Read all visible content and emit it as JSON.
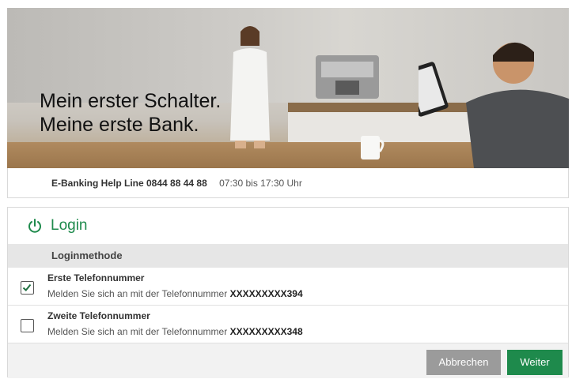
{
  "banner": {
    "line1": "Mein erster Schalter.",
    "line2": "Meine erste Bank."
  },
  "helpline": {
    "label": "E-Banking Help Line 0844 88 44 88",
    "hours": "07:30 bis 17:30 Uhr"
  },
  "login": {
    "title": "Login",
    "method_header": "Loginmethode",
    "options": [
      {
        "title": "Erste Telefonnummer",
        "desc_prefix": "Melden Sie sich an mit der Telefonnummer",
        "number": "XXXXXXXXX394",
        "checked": true
      },
      {
        "title": "Zweite Telefonnummer",
        "desc_prefix": "Melden Sie sich an mit der Telefonnummer",
        "number": "XXXXXXXXX348",
        "checked": false
      }
    ],
    "cancel_label": "Abbrechen",
    "next_label": "Weiter"
  },
  "colors": {
    "accent": "#1e8a4c",
    "cancel": "#9b9b9b",
    "method_bar": "#e6e6e6"
  }
}
